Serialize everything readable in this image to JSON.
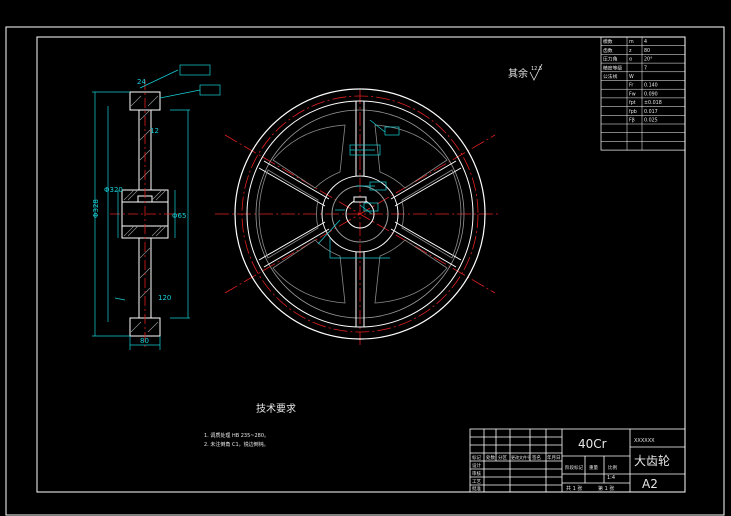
{
  "drawing": {
    "roughness_note": "其余",
    "roughness_value": "12.5",
    "tech_title": "技术要求",
    "tech_notes": [
      "1. 调质处理 HB 235~280。",
      "2. 未注倒角 C1，锐边倒钝。"
    ],
    "material": "40Cr",
    "part_name": "大齿轮",
    "company": "XXXXXX",
    "sheet_size": "A2",
    "scale": "1:4",
    "sheet_info": [
      "共 1 张",
      "第 1 张"
    ],
    "colors": {
      "background": "#000000",
      "outline": "#ffffff",
      "dimension": "#16d0d8",
      "centerline": "#e02020",
      "hidden": "#9a9a9a"
    }
  },
  "params_table": {
    "rows": [
      [
        "模数",
        "m",
        "4"
      ],
      [
        "齿数",
        "z",
        "80"
      ],
      [
        "压力角",
        "α",
        "20°"
      ],
      [
        "精度等级",
        "",
        "7"
      ],
      [
        "公法线",
        "W",
        ""
      ],
      [
        "",
        "Fr",
        "0.140"
      ],
      [
        "",
        "Fw",
        "0.090"
      ],
      [
        "",
        "fpt",
        "±0.018"
      ],
      [
        "",
        "fpb",
        "0.017"
      ],
      [
        "",
        "Fβ",
        "0.025"
      ],
      [
        "",
        "",
        ""
      ],
      [
        "",
        "",
        ""
      ],
      [
        "",
        "",
        ""
      ]
    ]
  },
  "section_dims": {
    "top": "24",
    "face_width": "80",
    "bore": "Φ65",
    "d_tip": "Φ328",
    "d_pitch": "Φ320",
    "hub_len": "120",
    "rim": "12"
  },
  "title_block": {
    "labels": [
      "标记",
      "处数",
      "分区",
      "更改文件号",
      "签名",
      "年月日",
      "设计",
      "审核",
      "工艺",
      "批准"
    ],
    "stage_labels": [
      "阶段标记",
      "重量",
      "比例"
    ]
  }
}
